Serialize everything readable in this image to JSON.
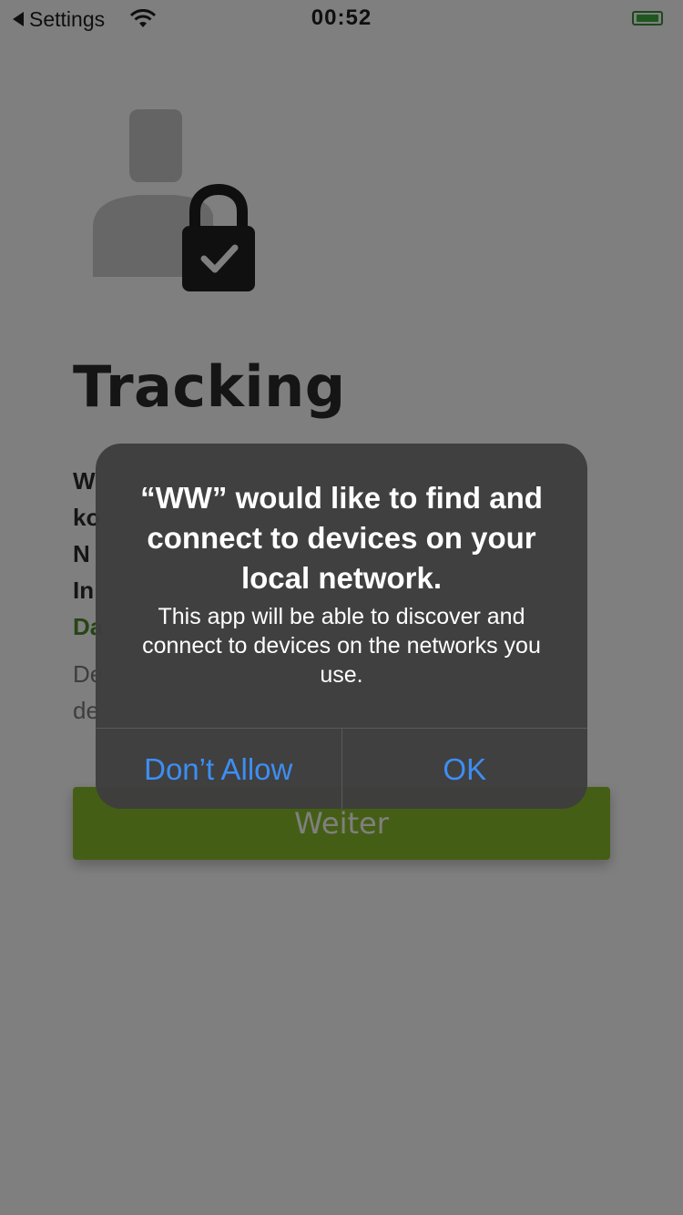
{
  "status_bar": {
    "back_label": "Settings",
    "time": "00:52"
  },
  "icons": {
    "wifi": "wifi-icon",
    "battery": "battery-icon",
    "header": "user-lock-check-icon"
  },
  "content": {
    "title": "Tracking",
    "body_lines": [
      "W",
      "ko",
      "N",
      "In"
    ],
    "link_fragment": "Da",
    "muted_lines": [
      "De",
      "de"
    ],
    "primary_button": "Weiter"
  },
  "alert": {
    "title": "“WW” would like to find and connect to devices on your local network.",
    "message": "This app will be able to discover and connect to devices on the networks you use.",
    "buttons": {
      "dont_allow": "Don’t Allow",
      "ok": "OK"
    }
  },
  "colors": {
    "accent_green": "#8bbd2a",
    "link_green": "#4f8a2b",
    "alert_button_blue": "#3d8ef5"
  }
}
